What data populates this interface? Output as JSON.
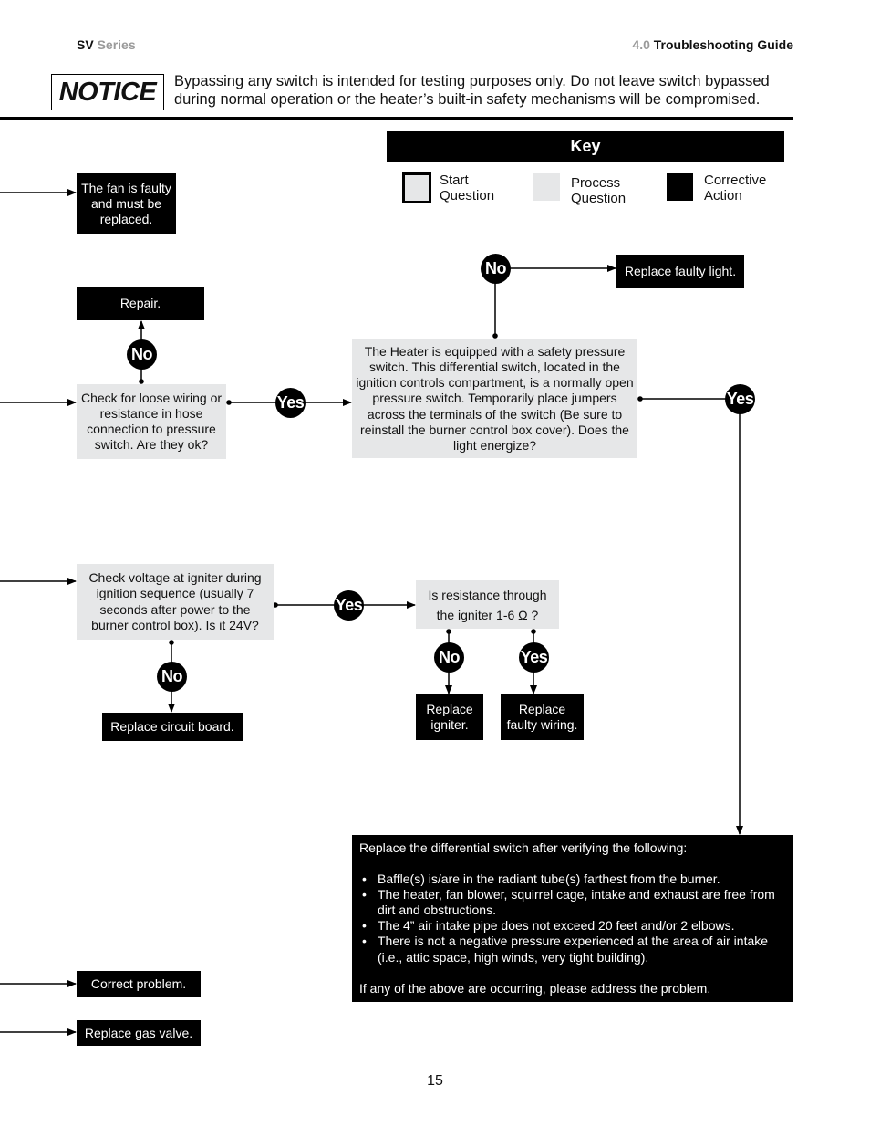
{
  "header": {
    "series_bold": "SV",
    "series_gray": "Series",
    "section_number": "4.0",
    "section_title": "Troubleshooting Guide"
  },
  "notice": {
    "label": "NOTICE",
    "text": "Bypassing any switch is intended for testing purposes only.  Do not leave switch bypassed during normal operation or the heater’s built-in safety mechanisms will be compromised."
  },
  "key": {
    "title": "Key",
    "items": [
      {
        "label_line1": "Start",
        "label_line2": "Question",
        "style": "start"
      },
      {
        "label_line1": "Process",
        "label_line2": "Question",
        "style": "process"
      },
      {
        "label_line1": "Corrective",
        "label_line2": "Action",
        "style": "corrective"
      }
    ]
  },
  "colors": {
    "process_fill": "#e6e7e8",
    "corrective_fill": "#000000",
    "accent_gray": "#9a9a9a"
  },
  "nodes": {
    "fan_faulty": "The fan is faulty and must be replaced.",
    "repair": "Repair.",
    "check_wiring": "Check for loose wiring or resistance in hose connection to pressure switch.  Are they ok?",
    "pressure_switch": "The Heater is equipped with a safety pressure switch.  This differential switch, located in the ignition controls compartment, is a normally open pressure switch.  Temporarily place jumpers across the terminals of the switch (Be sure to reinstall the burner control box cover).  Does the light energize?",
    "replace_light": "Replace faulty light.",
    "check_voltage": "Check voltage at igniter during ignition sequence (usually 7 seconds after power to the burner control box).  Is it 24V?",
    "replace_circuit_board": "Replace circuit board.",
    "igniter_resistance": "Is resistance through the igniter 1-6 Ω ?",
    "replace_igniter": "Replace igniter.",
    "replace_wiring": "Replace faulty wiring.",
    "correct_problem": "Correct problem.",
    "replace_gas_valve": "Replace gas valve."
  },
  "badges": {
    "no": "No",
    "yes": "Yes"
  },
  "differential_box": {
    "intro": "Replace the differential switch after verifying the following:",
    "bullets": [
      "Baffle(s) is/are in the radiant tube(s) farthest from the burner.",
      "The heater, fan blower, squirrel cage, intake and exhaust are free from dirt and obstructions.",
      "The 4” air intake pipe does not exceed 20 feet and/or 2 elbows.",
      "There is not a negative pressure experienced at the area of air intake (i.e., attic space, high winds, very tight building)."
    ],
    "outro": "If any of the above are occurring, please address the problem."
  },
  "page_number": "15"
}
